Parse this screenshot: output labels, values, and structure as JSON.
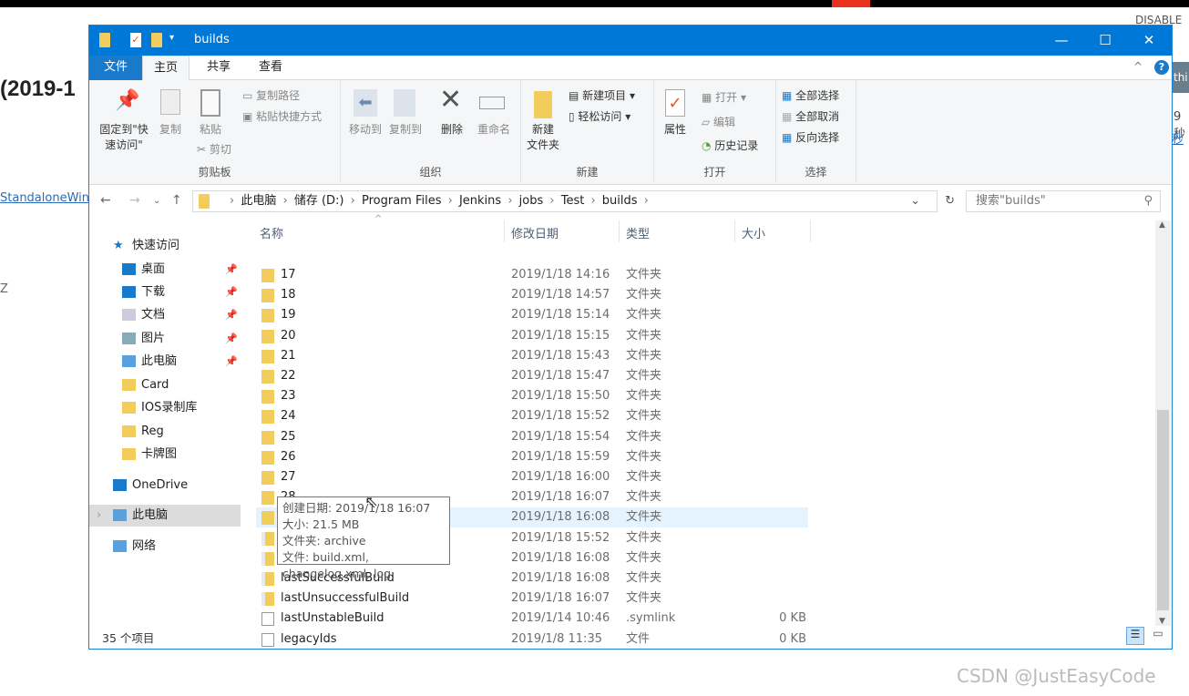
{
  "background": {
    "heading": "(2019-1",
    "link": "StandaloneWin",
    "disable": "DISABLE",
    "side_btn": "thi",
    "side_text1": "9 秒",
    "side_text2": "秒",
    "left_char": "Z",
    "watermark": "CSDN @JustEasyCode"
  },
  "window": {
    "title": "builds",
    "accent": "#0078d7",
    "controls": {
      "minimize": "—",
      "maximize": "☐",
      "close": "✕"
    }
  },
  "tabs": [
    {
      "label": "文件",
      "active": false
    },
    {
      "label": "主页",
      "active": true
    },
    {
      "label": "共享"
    },
    {
      "label": "查看"
    }
  ],
  "ribbon": {
    "clipboard": {
      "label": "剪贴板",
      "pin": "固定到\"快速访问\"",
      "copy": "复制",
      "paste": "粘贴",
      "copy_path": "复制路径",
      "paste_shortcut": "粘贴快捷方式",
      "cut": "剪切"
    },
    "organize": {
      "label": "组织",
      "move_to": "移动到",
      "copy_to": "复制到",
      "delete": "删除",
      "rename": "重命名"
    },
    "new": {
      "label": "新建",
      "new_folder": "新建\n文件夹",
      "new_item": "新建项目 ▾",
      "easy_access": "轻松访问 ▾"
    },
    "open": {
      "label": "打开",
      "properties": "属性",
      "open": "打开 ▾",
      "edit": "编辑",
      "history": "历史记录"
    },
    "select": {
      "label": "选择",
      "select_all": "全部选择",
      "select_none": "全部取消",
      "invert": "反向选择"
    }
  },
  "address": {
    "crumbs": [
      "此电脑",
      "储存 (D:)",
      "Program Files",
      "Jenkins",
      "jobs",
      "Test",
      "builds"
    ],
    "search_placeholder": "搜索\"builds\""
  },
  "nav": [
    {
      "label": "快速访问",
      "icon": "star-icon"
    },
    {
      "label": "桌面",
      "icon": "desktop-icon",
      "pinned": true
    },
    {
      "label": "下载",
      "icon": "download-icon",
      "pinned": true
    },
    {
      "label": "文档",
      "icon": "document-icon",
      "pinned": true
    },
    {
      "label": "图片",
      "icon": "pictures-icon",
      "pinned": true
    },
    {
      "label": "此电脑",
      "icon": "computer-icon",
      "pinned": true
    },
    {
      "label": "Card",
      "icon": "folder-icon"
    },
    {
      "label": "IOS录制库",
      "icon": "folder-icon"
    },
    {
      "label": "Reg",
      "icon": "folder-icon"
    },
    {
      "label": "卡牌图",
      "icon": "folder-icon"
    },
    {
      "label": "OneDrive",
      "icon": "cloud-icon"
    },
    {
      "label": "此电脑",
      "icon": "computer-icon",
      "selected": true
    },
    {
      "label": "网络",
      "icon": "network-icon"
    }
  ],
  "columns": {
    "name": "名称",
    "date": "修改日期",
    "type": "类型",
    "size": "大小"
  },
  "files": [
    {
      "name": "17",
      "date": "2019/1/18 14:16",
      "type": "文件夹",
      "size": "",
      "kind": "folder"
    },
    {
      "name": "18",
      "date": "2019/1/18 14:57",
      "type": "文件夹",
      "size": "",
      "kind": "folder"
    },
    {
      "name": "19",
      "date": "2019/1/18 15:14",
      "type": "文件夹",
      "size": "",
      "kind": "folder"
    },
    {
      "name": "20",
      "date": "2019/1/18 15:15",
      "type": "文件夹",
      "size": "",
      "kind": "folder"
    },
    {
      "name": "21",
      "date": "2019/1/18 15:43",
      "type": "文件夹",
      "size": "",
      "kind": "folder"
    },
    {
      "name": "22",
      "date": "2019/1/18 15:47",
      "type": "文件夹",
      "size": "",
      "kind": "folder"
    },
    {
      "name": "23",
      "date": "2019/1/18 15:50",
      "type": "文件夹",
      "size": "",
      "kind": "folder"
    },
    {
      "name": "24",
      "date": "2019/1/18 15:52",
      "type": "文件夹",
      "size": "",
      "kind": "folder"
    },
    {
      "name": "25",
      "date": "2019/1/18 15:54",
      "type": "文件夹",
      "size": "",
      "kind": "folder"
    },
    {
      "name": "26",
      "date": "2019/1/18 15:59",
      "type": "文件夹",
      "size": "",
      "kind": "folder"
    },
    {
      "name": "27",
      "date": "2019/1/18 16:00",
      "type": "文件夹",
      "size": "",
      "kind": "folder"
    },
    {
      "name": "28",
      "date": "2019/1/18 16:07",
      "type": "文件夹",
      "size": "",
      "kind": "folder"
    },
    {
      "name": "29",
      "date": "2019/1/18 16:08",
      "type": "文件夹",
      "size": "",
      "kind": "folder",
      "hover": true
    },
    {
      "name": "lastFailedBuild",
      "date": "2019/1/18 15:52",
      "type": "文件夹",
      "size": "",
      "kind": "link"
    },
    {
      "name": "lastStableBuild",
      "date": "2019/1/18 16:08",
      "type": "文件夹",
      "size": "",
      "kind": "link"
    },
    {
      "name": "lastSuccessfulBuild",
      "date": "2019/1/18 16:08",
      "type": "文件夹",
      "size": "",
      "kind": "link"
    },
    {
      "name": "lastUnsuccessfulBuild",
      "date": "2019/1/18 16:07",
      "type": "文件夹",
      "size": "",
      "kind": "link"
    },
    {
      "name": "lastUnstableBuild",
      "date": "2019/1/14 10:46",
      "type": ".symlink",
      "size": "0 KB",
      "kind": "file"
    },
    {
      "name": "legacyIds",
      "date": "2019/1/8 11:35",
      "type": "文件",
      "size": "0 KB",
      "kind": "file"
    }
  ],
  "tooltip": {
    "created": "创建日期: 2019/1/18 16:07",
    "size": "大小: 21.5 MB",
    "folders": "文件夹: archive",
    "files": "文件: build.xml, changelog.xml, log"
  },
  "status": {
    "count": "35 个项目"
  }
}
